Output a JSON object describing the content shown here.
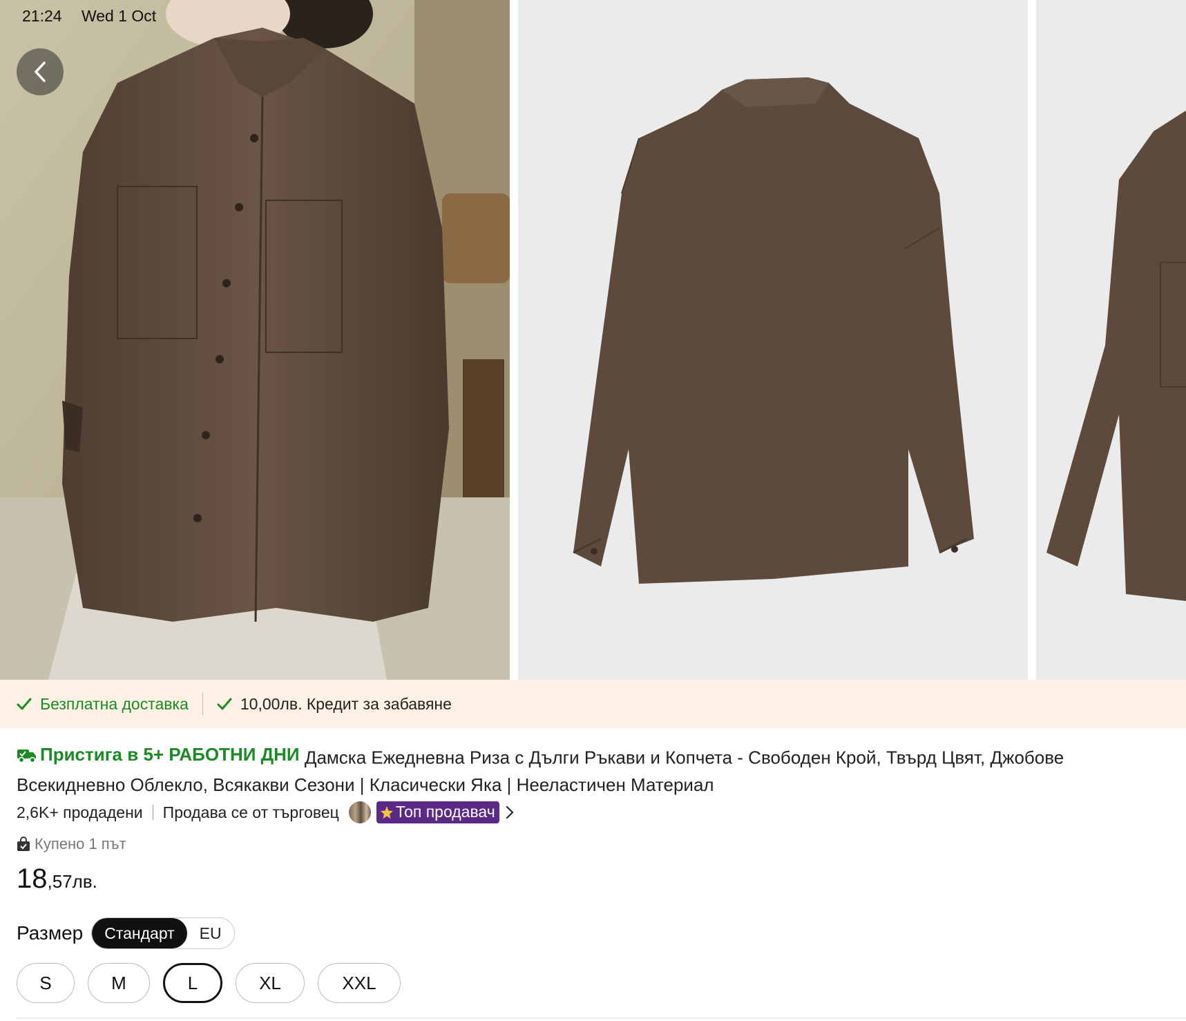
{
  "status_bar": {
    "time": "21:24",
    "date": "Wed 1 Oct"
  },
  "gallery": {
    "images": [
      {
        "alt": "Model wearing brown shirt"
      },
      {
        "alt": "Brown shirt back view"
      },
      {
        "alt": "Brown shirt partial view"
      }
    ]
  },
  "promo": {
    "free_delivery": "Безплатна доставка",
    "credit": "10,00лв. Кредит за забавяне"
  },
  "product": {
    "delivery_badge": "Пристига в 5+ РАБОТНИ ДНИ",
    "title_line1": "Дамска Ежедневна Риза с Дълги Ръкави и Копчета - Свободен Крой, Твърд Цвят, Джобове",
    "title_line2": "Всекидневно Облекло, Всякакви Сезони | Класически Яка | Нееластичен Материал",
    "sold": "2,6K+ продадени",
    "seller_text": "Продава се от търговец",
    "top_seller": "Топ продавач",
    "bought": "Купено 1 път",
    "price_int": "18",
    "price_dec": ",57",
    "price_currency": "лв."
  },
  "size": {
    "label": "Размер",
    "standards": [
      "Стандарт",
      "EU"
    ],
    "selected_standard": "Стандарт",
    "options": [
      "S",
      "M",
      "L",
      "XL",
      "XXL"
    ],
    "selected": "L"
  },
  "colors": {
    "green": "#1a8a25",
    "promo_bg": "#fdf0e4",
    "purple": "#5b2a86",
    "shirt": "#5d4a3d"
  },
  "icons": [
    "chevron-left-icon",
    "check-icon",
    "truck-icon",
    "star-icon",
    "chevron-right-icon",
    "shopping-bag-icon"
  ]
}
